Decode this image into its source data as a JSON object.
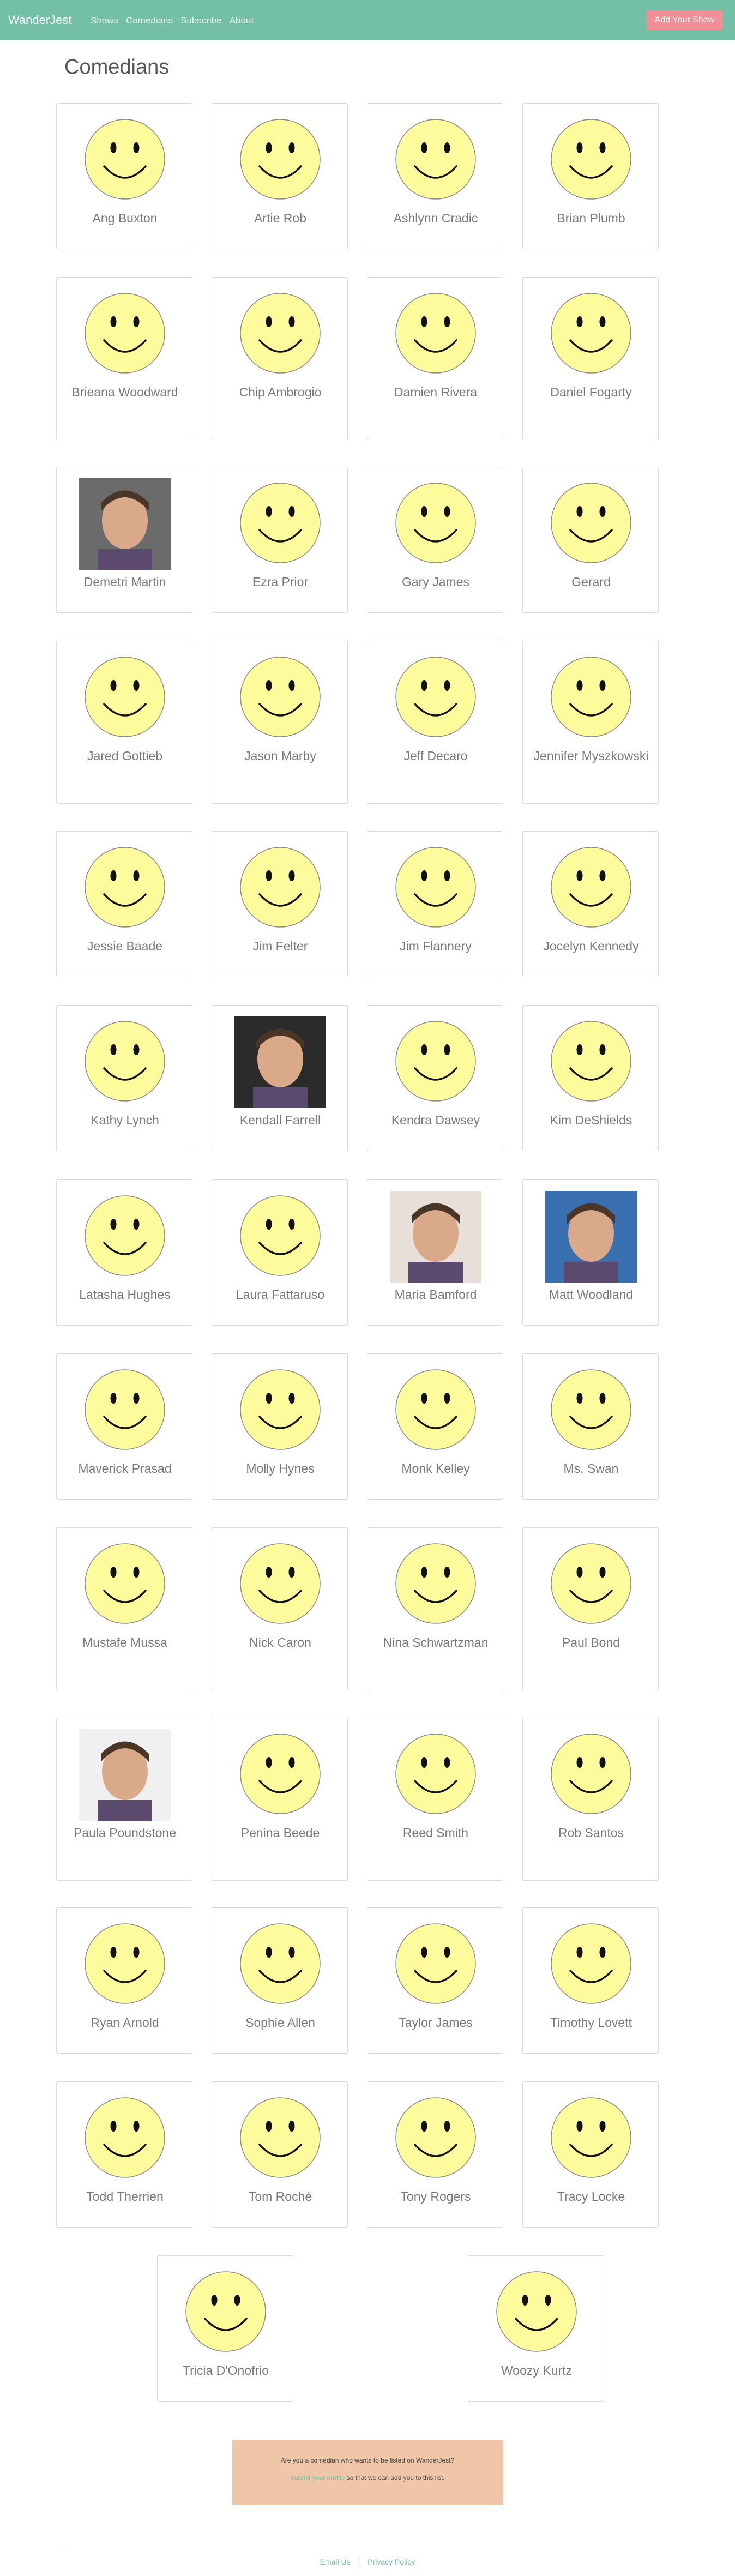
{
  "nav": {
    "brand": "WanderJest",
    "links": [
      "Shows",
      "Comedians",
      "Subscribe",
      "About"
    ],
    "button": "Add Your Show"
  },
  "page": {
    "title": "Comedians"
  },
  "comedians": [
    {
      "name": "Ang Buxton",
      "avatar": "smiley-icon"
    },
    {
      "name": "Artie Rob",
      "avatar": "smiley-icon"
    },
    {
      "name": "Ashlynn Cradic",
      "avatar": "smiley-icon"
    },
    {
      "name": "Brian Plumb",
      "avatar": "smiley-icon"
    },
    {
      "name": "Brieana Woodward",
      "avatar": "smiley-icon"
    },
    {
      "name": "Chip Ambrogio",
      "avatar": "smiley-icon"
    },
    {
      "name": "Damien Rivera",
      "avatar": "smiley-icon"
    },
    {
      "name": "Daniel Fogarty",
      "avatar": "smiley-icon"
    },
    {
      "name": "Demetri Martin",
      "avatar": "photo"
    },
    {
      "name": "Ezra Prior",
      "avatar": "smiley-icon"
    },
    {
      "name": "Gary James",
      "avatar": "smiley-icon"
    },
    {
      "name": "Gerard",
      "avatar": "smiley-icon"
    },
    {
      "name": "Jared Gottieb",
      "avatar": "smiley-icon"
    },
    {
      "name": "Jason Marby",
      "avatar": "smiley-icon"
    },
    {
      "name": "Jeff Decaro",
      "avatar": "smiley-icon"
    },
    {
      "name": "Jennifer Myszkowski",
      "avatar": "smiley-icon"
    },
    {
      "name": "Jessie Baade",
      "avatar": "smiley-icon"
    },
    {
      "name": "Jim Felter",
      "avatar": "smiley-icon"
    },
    {
      "name": "Jim Flannery",
      "avatar": "smiley-icon"
    },
    {
      "name": "Jocelyn Kennedy",
      "avatar": "smiley-icon"
    },
    {
      "name": "Kathy Lynch",
      "avatar": "smiley-icon"
    },
    {
      "name": "Kendall Farrell",
      "avatar": "photo"
    },
    {
      "name": "Kendra Dawsey",
      "avatar": "smiley-icon"
    },
    {
      "name": "Kim DeShields",
      "avatar": "smiley-icon"
    },
    {
      "name": "Latasha Hughes",
      "avatar": "smiley-icon"
    },
    {
      "name": "Laura Fattaruso",
      "avatar": "smiley-icon"
    },
    {
      "name": "Maria Bamford",
      "avatar": "photo"
    },
    {
      "name": "Matt Woodland",
      "avatar": "photo"
    },
    {
      "name": "Maverick Prasad",
      "avatar": "smiley-icon"
    },
    {
      "name": "Molly Hynes",
      "avatar": "smiley-icon"
    },
    {
      "name": "Monk Kelley",
      "avatar": "smiley-icon"
    },
    {
      "name": "Ms. Swan",
      "avatar": "smiley-icon"
    },
    {
      "name": "Mustafe Mussa",
      "avatar": "smiley-icon"
    },
    {
      "name": "Nick Caron",
      "avatar": "smiley-icon"
    },
    {
      "name": "Nina Schwartzman",
      "avatar": "smiley-icon"
    },
    {
      "name": "Paul Bond",
      "avatar": "smiley-icon"
    },
    {
      "name": "Paula Poundstone",
      "avatar": "photo"
    },
    {
      "name": "Penina Beede",
      "avatar": "smiley-icon"
    },
    {
      "name": "Reed Smith",
      "avatar": "smiley-icon"
    },
    {
      "name": "Rob Santos",
      "avatar": "smiley-icon"
    },
    {
      "name": "Ryan Arnold",
      "avatar": "smiley-icon"
    },
    {
      "name": "Sophie Allen",
      "avatar": "smiley-icon"
    },
    {
      "name": "Taylor James",
      "avatar": "smiley-icon"
    },
    {
      "name": "Timothy Lovett",
      "avatar": "smiley-icon"
    },
    {
      "name": "Todd Therrien",
      "avatar": "smiley-icon"
    },
    {
      "name": "Tom Roché",
      "avatar": "smiley-icon"
    },
    {
      "name": "Tony Rogers",
      "avatar": "smiley-icon"
    },
    {
      "name": "Tracy Locke",
      "avatar": "smiley-icon"
    },
    {
      "name": "Tricia D'Onofrio",
      "avatar": "smiley-icon"
    },
    {
      "name": "Woozy Kurtz",
      "avatar": "smiley-icon"
    }
  ],
  "cta": {
    "question": "Are you a comedian who wants to be listed on WanderJest?",
    "link_text": "Submit your profile",
    "after_link": " so that we can add you to this list."
  },
  "footer": {
    "links": [
      "Email Us",
      "Privacy Policy"
    ],
    "separator": "|"
  },
  "colors": {
    "navbar": "#73c0a6",
    "button": "#f28e96",
    "smiley": "#fefb9c",
    "cta_bg": "#efc7a8"
  }
}
